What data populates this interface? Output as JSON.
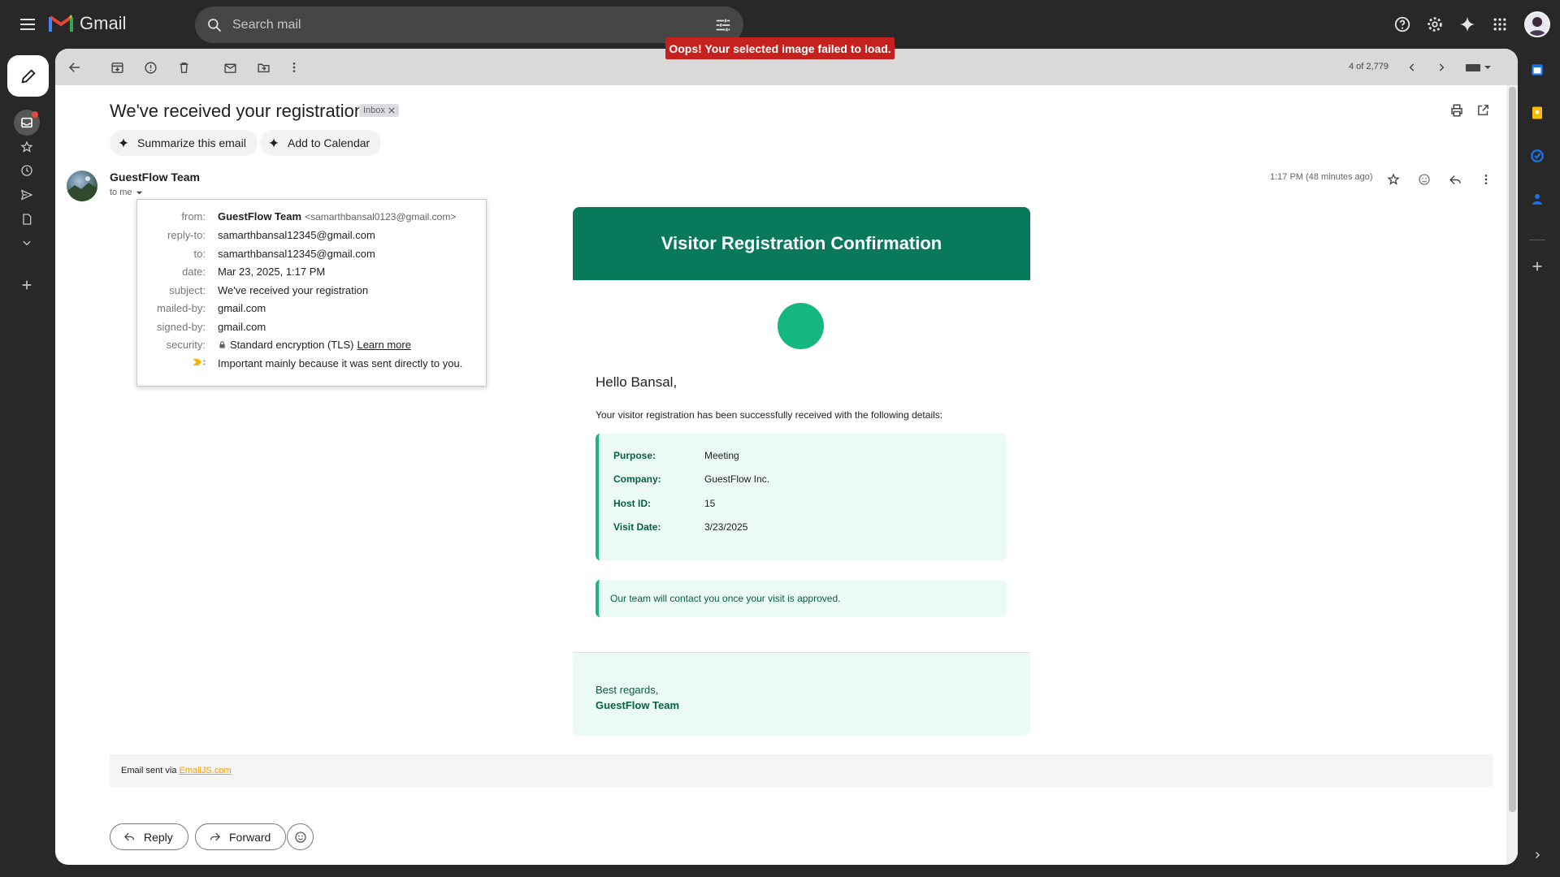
{
  "app": {
    "name": "Gmail"
  },
  "search": {
    "placeholder": "Search mail"
  },
  "toast": "Oops! Your selected image failed to load.",
  "pager": {
    "text": "4 of 2,779"
  },
  "message": {
    "subject": "We've received your registration",
    "label_chip": "Inbox",
    "actions": {
      "summarize": "Summarize this email",
      "calendar": "Add to Calendar"
    },
    "sender_name": "GuestFlow Team",
    "to_me": "to me",
    "time": "1:17 PM (48 minutes ago)"
  },
  "details": {
    "from_label": "from:",
    "from_name": "GuestFlow Team",
    "from_email": "<samarthbansal0123@gmail.com>",
    "reply_to_label": "reply-to:",
    "reply_to": "samarthbansal12345@gmail.com",
    "to_label": "to:",
    "to": "samarthbansal12345@gmail.com",
    "date_label": "date:",
    "date": "Mar 23, 2025, 1:17 PM",
    "subject_label": "subject:",
    "subject": "We've received your registration",
    "mailed_by_label": "mailed-by:",
    "mailed_by": "gmail.com",
    "signed_by_label": "signed-by:",
    "signed_by": "gmail.com",
    "security_label": "security:",
    "security": "Standard encryption (TLS)",
    "learn_more": "Learn more",
    "importance": "Important mainly because it was sent directly to you."
  },
  "email": {
    "header_title": "Visitor Registration Confirmation",
    "greeting": "Hello Bansal,",
    "intro": "Your visitor registration has been successfully received with the following details:",
    "fields": [
      {
        "key": "Purpose:",
        "value": "Meeting"
      },
      {
        "key": "Company:",
        "value": "GuestFlow Inc."
      },
      {
        "key": "Host ID:",
        "value": "15"
      },
      {
        "key": "Visit Date:",
        "value": "3/23/2025"
      }
    ],
    "notice": "Our team will contact you once your visit is approved.",
    "regards": "Best regards,",
    "signature": "GuestFlow Team",
    "accent_color": "#087a5b"
  },
  "sent_via": {
    "prefix": "Email sent via",
    "link": "EmailJS.com"
  },
  "reply_actions": {
    "reply": "Reply",
    "forward": "Forward"
  }
}
